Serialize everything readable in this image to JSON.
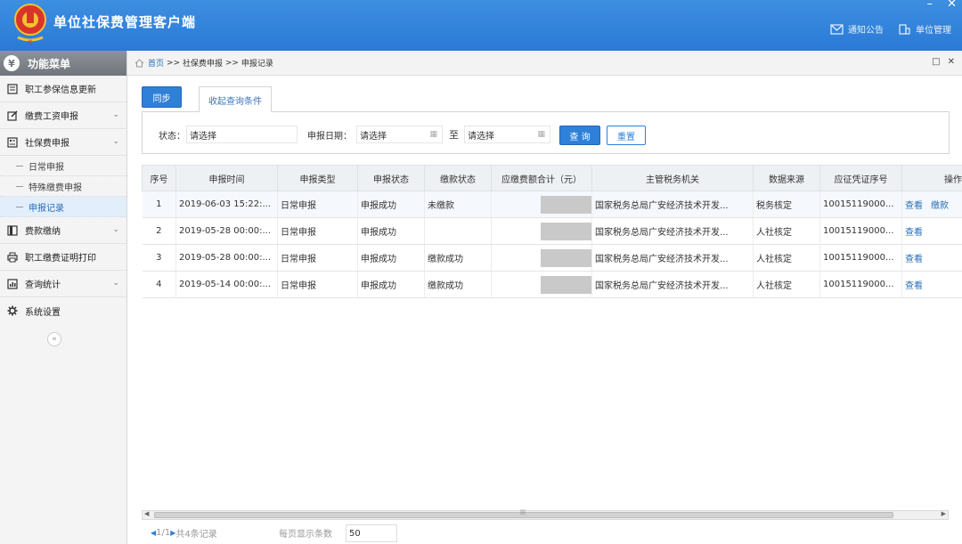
{
  "header": {
    "title": "单位社保费管理客户端",
    "links": [
      "通知公告",
      "单位管理"
    ],
    "win_min": "–",
    "win_close": "✕"
  },
  "sidebar": {
    "title": "功能菜单",
    "yen": "¥",
    "items": [
      {
        "label": "职工参保信息更新",
        "icon": "document-icon"
      },
      {
        "label": "缴费工资申报",
        "icon": "edit-icon",
        "chev": "⌄"
      },
      {
        "label": "社保费申报",
        "icon": "form-icon",
        "chev": "⌄"
      },
      {
        "label": "费款缴纳",
        "icon": "book-icon",
        "chev": "⌄"
      },
      {
        "label": "职工缴费证明打印",
        "icon": "printer-icon"
      },
      {
        "label": "查询统计",
        "icon": "chart-icon",
        "chev": "⌄"
      },
      {
        "label": "系统设置",
        "icon": "gear-icon"
      }
    ],
    "sub_items": [
      "日常申报",
      "特殊缴费申报",
      "申报记录"
    ],
    "collapse": "«"
  },
  "breadcrumb": {
    "home": "首页",
    "sep": ">>",
    "level1": "社保费申报",
    "level2": "申报记录",
    "tool1": "□",
    "tool2": "✕"
  },
  "toolbar": {
    "sync_label": "同步",
    "filter_tab": "收起查询条件"
  },
  "filter": {
    "status_label": "状态：",
    "status_value": "请选择",
    "date_label": "申报日期：",
    "date_from": "请选择",
    "to_label": "至",
    "date_to": "请选择",
    "query_label": "查 询",
    "reset_label": "重置"
  },
  "table": {
    "columns": [
      "序号",
      "申报时间",
      "申报类型",
      "申报状态",
      "缴款状态",
      "应缴费额合计（元）",
      "主管税务机关",
      "数据来源",
      "应征凭证序号",
      "操作"
    ],
    "rows": [
      {
        "idx": "1",
        "time": "2019-06-03 15:22:...",
        "type": "日常申报",
        "status": "申报成功",
        "pay": "未缴款",
        "office": "国家税务总局广安经济技术开发...",
        "source": "税务核定",
        "voucher": "10015119000...",
        "actions": [
          "查看",
          "缴款"
        ]
      },
      {
        "idx": "2",
        "time": "2019-05-28 00:00:...",
        "type": "日常申报",
        "status": "申报成功",
        "pay": "",
        "office": "国家税务总局广安经济技术开发...",
        "source": "人社核定",
        "voucher": "10015119000...",
        "actions": [
          "查看"
        ]
      },
      {
        "idx": "3",
        "time": "2019-05-28 00:00:...",
        "type": "日常申报",
        "status": "申报成功",
        "pay": "缴款成功",
        "office": "国家税务总局广安经济技术开发...",
        "source": "人社核定",
        "voucher": "10015119000...",
        "actions": [
          "查看"
        ]
      },
      {
        "idx": "4",
        "time": "2019-05-14 00:00:...",
        "type": "日常申报",
        "status": "申报成功",
        "pay": "缴款成功",
        "office": "国家税务总局广安经济技术开发...",
        "source": "人社核定",
        "voucher": "10015119000...",
        "actions": [
          "查看"
        ]
      }
    ]
  },
  "pager": {
    "page": "1/1",
    "total": "共4条记录",
    "per_page_label": "每页显示条数",
    "per_page_value": "50"
  },
  "colors": {
    "header_blue": "#2a7ad6",
    "accent": "#2f80d8",
    "link": "#2a6fb8"
  }
}
